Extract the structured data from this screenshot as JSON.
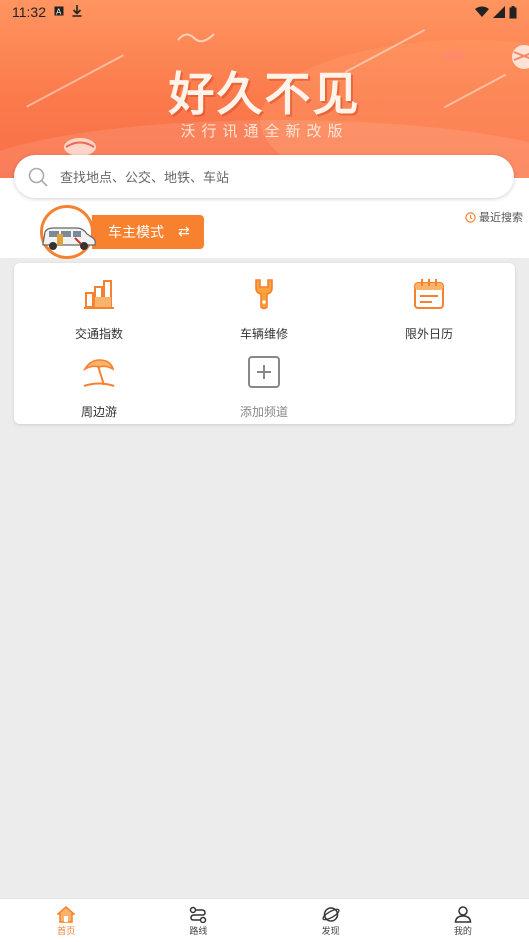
{
  "status_bar": {
    "time": "11:32"
  },
  "banner": {
    "title": "好久不见",
    "subtitle": "沃行讯通全新改版"
  },
  "search": {
    "placeholder": "查找地点、公交、地铁、车站"
  },
  "recent_search": {
    "label": "最近搜索"
  },
  "car_mode": {
    "label": "车主模式",
    "swap_glyph": "⇄"
  },
  "channels": [
    {
      "label": "交通指数",
      "icon": "bar-chart-icon"
    },
    {
      "label": "车辆维修",
      "icon": "wrench-icon"
    },
    {
      "label": "限外日历",
      "icon": "calendar-icon"
    },
    {
      "label": "周边游",
      "icon": "beach-umbrella-icon"
    },
    {
      "label": "添加频道",
      "icon": "add-icon"
    }
  ],
  "bottom_nav": [
    {
      "label": "首页",
      "icon": "home-icon",
      "active": true
    },
    {
      "label": "路线",
      "icon": "route-icon",
      "active": false
    },
    {
      "label": "发现",
      "icon": "planet-icon",
      "active": false
    },
    {
      "label": "我的",
      "icon": "user-icon",
      "active": false
    }
  ],
  "colors": {
    "accent": "#f7812f",
    "banner": "#fb7a4c",
    "background": "#ececec"
  }
}
